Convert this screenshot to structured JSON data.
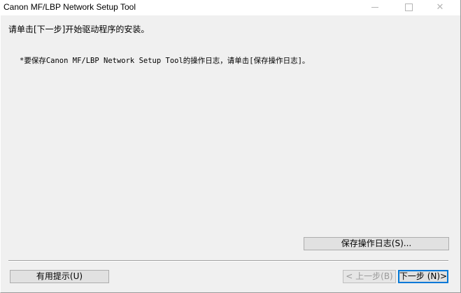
{
  "window": {
    "title": "Canon MF/LBP Network Setup Tool"
  },
  "main": {
    "instruction": "请单击[下一步]开始驱动程序的安装。",
    "note": "*要保存Canon MF/LBP Network Setup Tool的操作日志，请单击[保存操作日志]。"
  },
  "buttons": {
    "save_log": "保存操作日志(S)...",
    "hint": "有用提示(U)",
    "back": "< 上一步(B)",
    "next": "下一步 (N)>"
  },
  "colors": {
    "window_bg": "#f0f0f0",
    "focus_border": "#0078d7"
  }
}
